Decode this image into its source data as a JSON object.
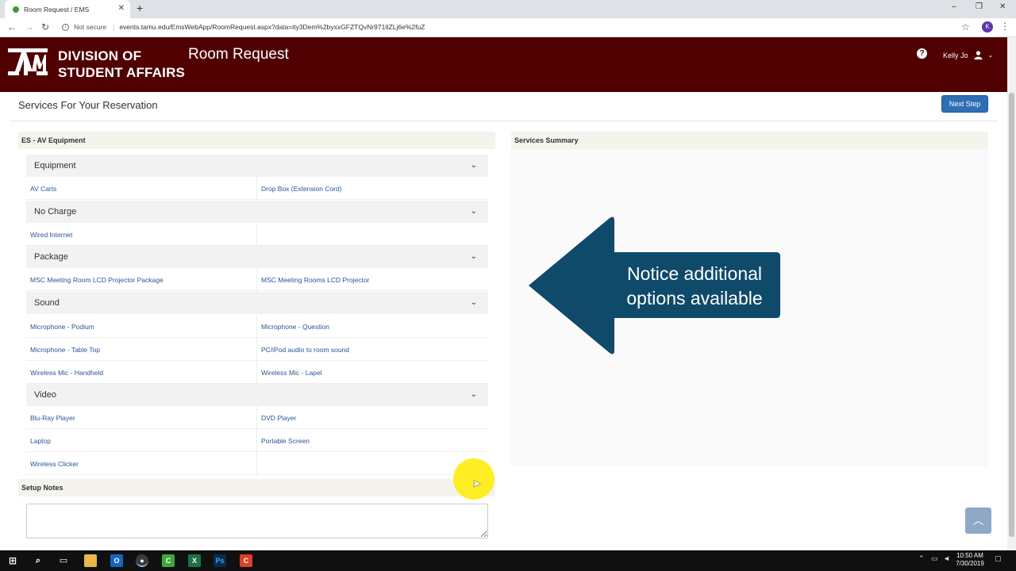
{
  "browser": {
    "tab_title": "Room Request / EMS",
    "tab_close": "✕",
    "new_tab": "+",
    "not_secure": "Not secure",
    "url": "events.tamu.edu/EmsWebApp/RoomRequest.aspx?data=ity3Dem%2byxxGFZTQvNr971lIZLj6e%2fuZ",
    "profile_initial": "K",
    "window_controls": [
      "–",
      "❐",
      "✕"
    ]
  },
  "header": {
    "division_line1": "DIVISION OF",
    "division_line2": "STUDENT AFFAIRS",
    "app_title": "Room Request",
    "help": "?",
    "user_name": "Kelly Jo",
    "brand_color": "#500000"
  },
  "page": {
    "title": "Services For Your Reservation",
    "next_step": "Next Step"
  },
  "services": {
    "panel_title": "ES - AV Equipment",
    "categories": [
      {
        "name": "Equipment",
        "rows": [
          [
            "AV Carts",
            "Drop Box (Extension Cord)"
          ]
        ]
      },
      {
        "name": "No Charge",
        "rows": [
          [
            "Wired Internet",
            ""
          ]
        ]
      },
      {
        "name": "Package",
        "rows": [
          [
            "MSC Meeting Room LCD Projector Package",
            "MSC Meeting Rooms LCD Projector"
          ]
        ]
      },
      {
        "name": "Sound",
        "rows": [
          [
            "Microphone - Podium",
            "Microphone - Question"
          ],
          [
            "Microphone - Table Top",
            "PC/iPod audio to room sound"
          ],
          [
            "Wireless Mic - Handheld",
            "Wireless Mic - Lapel"
          ]
        ]
      },
      {
        "name": "Video",
        "rows": [
          [
            "Blu-Ray Player",
            "DVD Player"
          ],
          [
            "Laptop",
            "Portable Screen"
          ],
          [
            "Wireless Clicker",
            ""
          ]
        ]
      }
    ]
  },
  "setup_notes": {
    "title": "Setup Notes",
    "value": ""
  },
  "summary": {
    "title": "Services Summary"
  },
  "callout": {
    "line1": "Notice additional",
    "line2": "options available",
    "color": "#0f4a6b"
  },
  "taskbar": {
    "time": "10:50 AM",
    "date": "7/30/2019"
  }
}
